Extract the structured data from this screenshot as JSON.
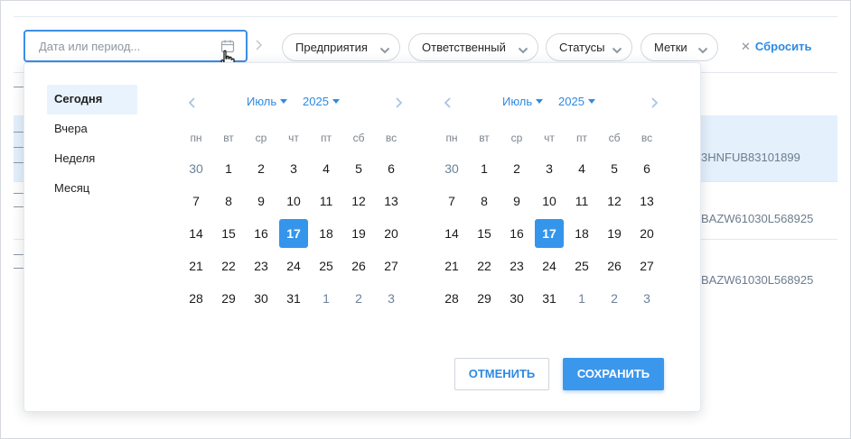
{
  "filters": {
    "date_placeholder": "Дата или период...",
    "pills": [
      {
        "label": "Предприятия"
      },
      {
        "label": "Ответственный"
      },
      {
        "label": "Статусы"
      },
      {
        "label": "Метки"
      }
    ],
    "reset_label": "Сбросить"
  },
  "background_rows": [
    "3HNFUB83101899",
    "BAZW61030L568925",
    "BAZW61030L568925"
  ],
  "quick_ranges": [
    "Сегодня",
    "Вчера",
    "Неделя",
    "Месяц"
  ],
  "active_quick_range": "Сегодня",
  "weekdays": [
    "пн",
    "вт",
    "ср",
    "чт",
    "пт",
    "сб",
    "вс"
  ],
  "calendars": [
    {
      "month": "Июль",
      "year": "2025",
      "weeks": [
        [
          "30",
          "1",
          "2",
          "3",
          "4",
          "5",
          "6"
        ],
        [
          "7",
          "8",
          "9",
          "10",
          "11",
          "12",
          "13"
        ],
        [
          "14",
          "15",
          "16",
          "17",
          "18",
          "19",
          "20"
        ],
        [
          "21",
          "22",
          "23",
          "24",
          "25",
          "26",
          "27"
        ],
        [
          "28",
          "29",
          "30",
          "31",
          "1",
          "2",
          "3"
        ]
      ]
    },
    {
      "month": "Июль",
      "year": "2025",
      "weeks": [
        [
          "30",
          "1",
          "2",
          "3",
          "4",
          "5",
          "6"
        ],
        [
          "7",
          "8",
          "9",
          "10",
          "11",
          "12",
          "13"
        ],
        [
          "14",
          "15",
          "16",
          "17",
          "18",
          "19",
          "20"
        ],
        [
          "21",
          "22",
          "23",
          "24",
          "25",
          "26",
          "27"
        ],
        [
          "28",
          "29",
          "30",
          "31",
          "1",
          "2",
          "3"
        ]
      ]
    }
  ],
  "selected_day": "17",
  "buttons": {
    "cancel": "ОТМЕНИТЬ",
    "save": "СОХРАНИТЬ"
  },
  "colors": {
    "accent": "#3495ea",
    "link": "#2d8ae3",
    "selected_bg": "#e9f3fd"
  },
  "icons": {
    "date": "calendar-icon",
    "cursor": "hand-pointer-icon",
    "dropdown": "chevron-down-icon",
    "reset": "close-icon"
  }
}
